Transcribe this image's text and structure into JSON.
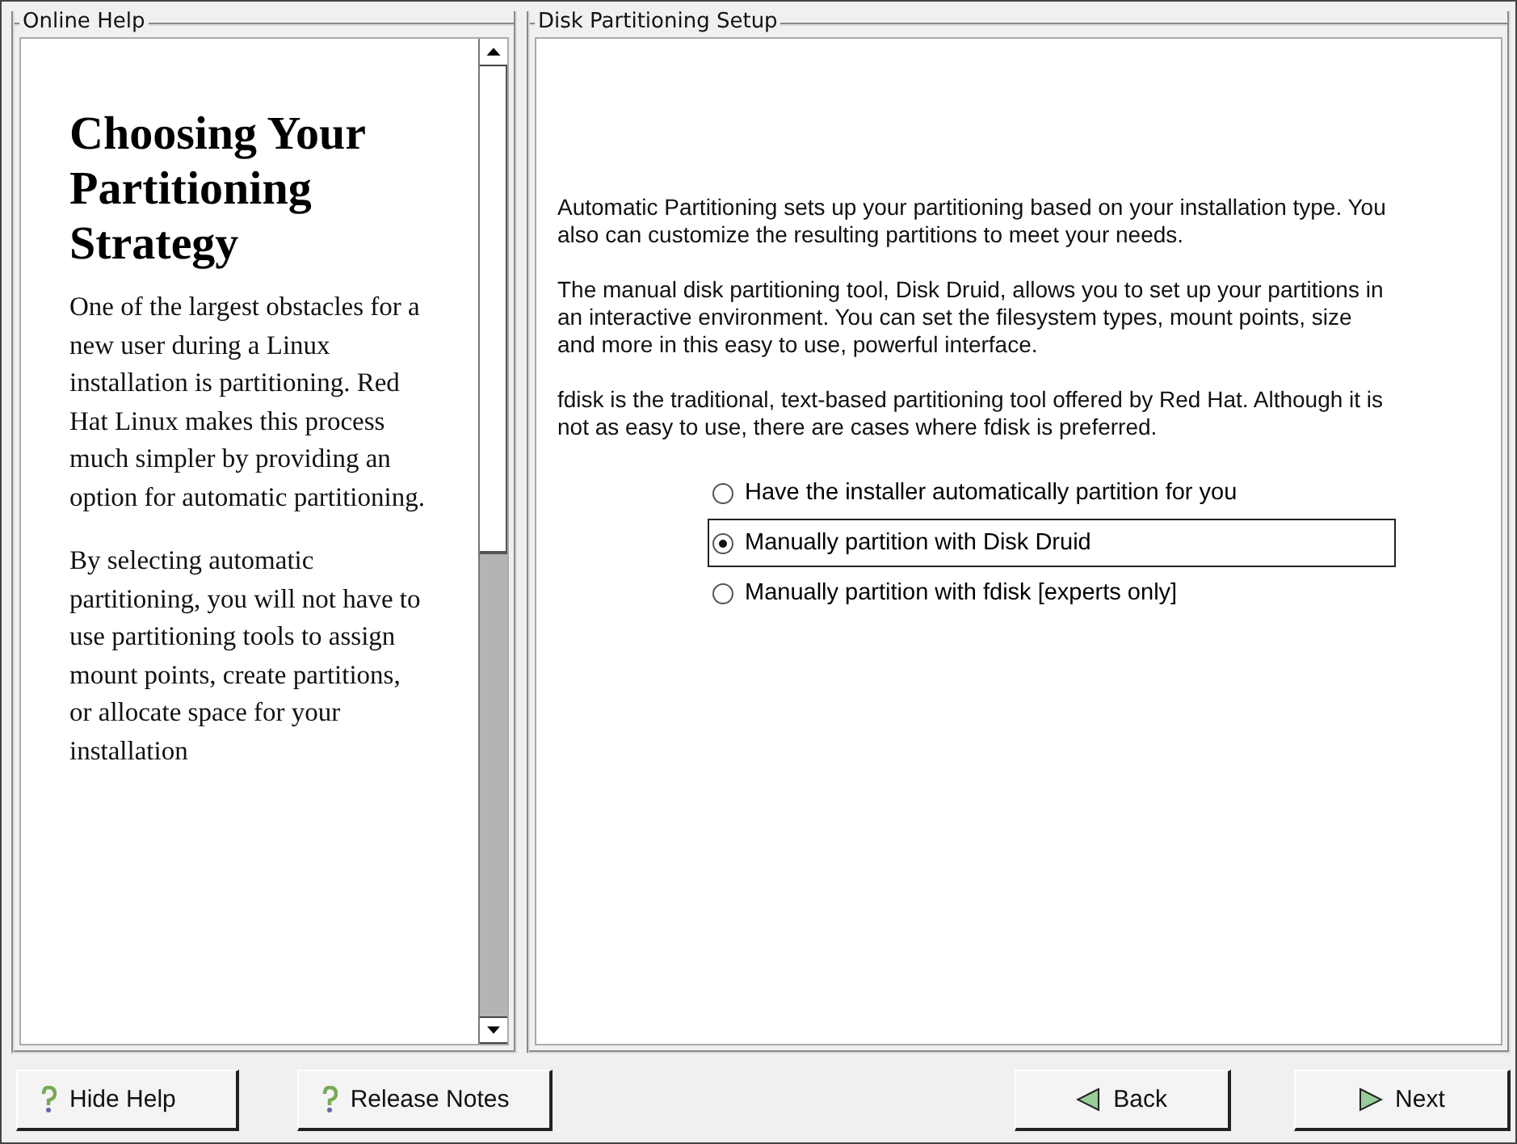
{
  "help": {
    "title": "Online Help",
    "heading": "Choosing Your Partitioning Strategy",
    "paragraphs": [
      "One of the largest obstacles for a new user during a Linux installation is partitioning. Red Hat Linux makes this process much simpler by providing an option for automatic partitioning.",
      "By selecting automatic partitioning, you will not have to use partitioning tools to assign mount points, create partitions, or allocate space for your installation"
    ]
  },
  "setup": {
    "title": "Disk Partitioning Setup",
    "paragraphs": [
      "Automatic Partitioning sets up your partitioning based on your installation type. You also can customize the resulting partitions to meet your needs.",
      "The manual disk partitioning tool, Disk Druid, allows you to set up your partitions in an interactive environment. You can set the filesystem types, mount points, size and more in this easy to use, powerful interface.",
      "fdisk is the traditional, text-based partitioning tool offered by Red Hat. Although it is not as easy to use, there are cases where fdisk is preferred."
    ],
    "options": [
      {
        "label": "Have the installer automatically partition for you",
        "selected": false
      },
      {
        "label": "Manually partition with Disk Druid",
        "selected": true
      },
      {
        "label": "Manually partition with fdisk [experts only]",
        "selected": false
      }
    ]
  },
  "buttons": [
    {
      "label": "Hide Help",
      "kind": "help"
    },
    {
      "label": "Release Notes",
      "kind": "help"
    },
    {
      "label": "Back",
      "kind": "back"
    },
    {
      "label": "Next",
      "kind": "next"
    }
  ]
}
